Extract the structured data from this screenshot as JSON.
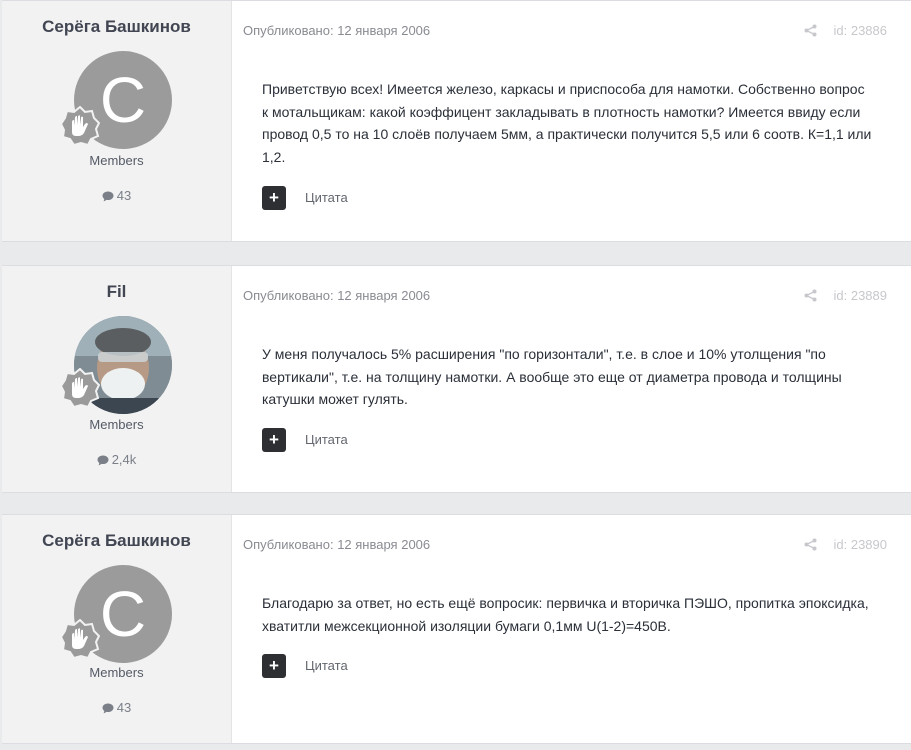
{
  "posts": [
    {
      "author": "Серёга Башкинов",
      "avatar_letter": "С",
      "role": "Members",
      "count": "43",
      "published": "Опубликовано: 12 января 2006",
      "post_id": "id: 23886",
      "body": "Приветствую всех! Имеется железо, каркасы и приспособа для намотки. Собственно вопрос к мотальщикам: какой коэффицент закладывать в плотность намотки? Имеется ввиду если провод 0,5 то на 10 слоёв получаем 5мм, а практически получится 5,5 или 6 соотв. К=1,1 или 1,2.",
      "quote_icon": "plus-icon",
      "quote_label": "Цитата"
    },
    {
      "author": "Fil",
      "role": "Members",
      "count": "2,4k",
      "published": "Опубликовано: 12 января 2006",
      "post_id": "id: 23889",
      "body": "У меня получалось 5% расширения \"по горизонтали\", т.е. в слое и 10% утолщения \"по вертикали\", т.е. на толщину намотки. А вообще это еще от диаметра провода и толщины катушки может гулять.",
      "quote_icon": "plus-icon",
      "quote_label": "Цитата"
    },
    {
      "author": "Серёга Башкинов",
      "avatar_letter": "С",
      "role": "Members",
      "count": "43",
      "published": "Опубликовано: 12 января 2006",
      "post_id": "id: 23890",
      "body": "Благодарю за ответ, но есть ещё вопросик: первичка и вторичка ПЭШО, пропитка эпоксидка, хватитли межсекционной изоляции бумаги 0,1мм U(1-2)=450В.",
      "quote_icon": "plus-icon",
      "quote_label": "Цитата"
    }
  ]
}
